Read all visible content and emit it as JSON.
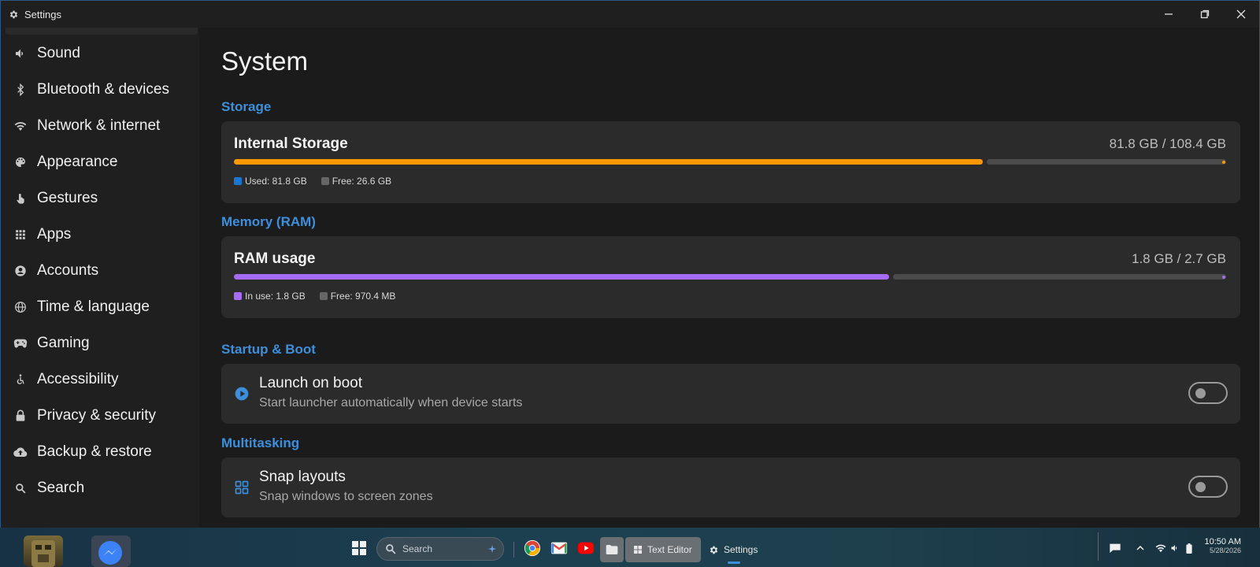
{
  "window": {
    "title": "Settings"
  },
  "sidebar": {
    "items": [
      {
        "label": "Sound",
        "icon": "speaker-icon"
      },
      {
        "label": "Bluetooth & devices",
        "icon": "bluetooth-icon"
      },
      {
        "label": "Network & internet",
        "icon": "wifi-icon"
      },
      {
        "label": "Appearance",
        "icon": "palette-icon"
      },
      {
        "label": "Gestures",
        "icon": "gesture-hand-icon"
      },
      {
        "label": "Apps",
        "icon": "apps-grid-icon"
      },
      {
        "label": "Accounts",
        "icon": "account-circle-icon"
      },
      {
        "label": "Time & language",
        "icon": "globe-icon"
      },
      {
        "label": "Gaming",
        "icon": "gamepad-icon"
      },
      {
        "label": "Accessibility",
        "icon": "accessibility-icon"
      },
      {
        "label": "Privacy & security",
        "icon": "lock-icon"
      },
      {
        "label": "Backup & restore",
        "icon": "cloud-upload-icon"
      },
      {
        "label": "Search",
        "icon": "search-icon"
      }
    ]
  },
  "main": {
    "title": "System",
    "storage": {
      "heading": "Storage",
      "title": "Internal Storage",
      "value": "81.8 GB / 108.4 GB",
      "used_fraction": 0.755,
      "used_color": "#ff9800",
      "legend_used": "Used: 81.8 GB",
      "legend_free": "Free: 26.6 GB",
      "legend_used_color": "#1976d2"
    },
    "memory": {
      "heading": "Memory (RAM)",
      "title": "RAM usage",
      "value": "1.8 GB / 2.7 GB",
      "used_fraction": 0.66,
      "used_color": "#a66bf5",
      "legend_used": "In use: 1.8 GB",
      "legend_free": "Free: 970.4 MB"
    },
    "startup": {
      "heading": "Startup & Boot",
      "title": "Launch on boot",
      "subtitle": "Start launcher automatically when device starts",
      "enabled": false
    },
    "multitasking": {
      "heading": "Multitasking",
      "title": "Snap layouts",
      "subtitle": "Snap windows to screen zones",
      "enabled": false
    }
  },
  "taskbar": {
    "search_placeholder": "Search",
    "tasks": [
      {
        "label": "Text Editor"
      },
      {
        "label": "Settings"
      }
    ],
    "time": "10:50 AM",
    "date": "5/28/2026",
    "accent": "#3d8fdc"
  }
}
